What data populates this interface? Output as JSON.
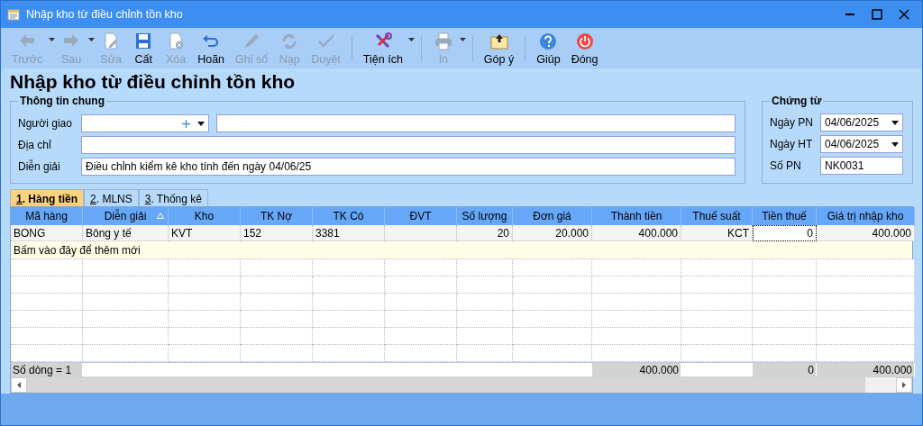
{
  "window": {
    "title": "Nhập kho từ điều chỉnh tồn kho"
  },
  "toolbar": [
    [
      {
        "label": "Trước",
        "kind": "back",
        "disabled": true,
        "dropdown": true
      },
      {
        "label": "Sau",
        "kind": "forward",
        "disabled": true,
        "dropdown": true
      },
      {
        "label": "Sửa",
        "kind": "edit",
        "disabled": true,
        "dropdown": false
      },
      {
        "label": "Cất",
        "kind": "save",
        "disabled": false,
        "dropdown": false
      },
      {
        "label": "Xóa",
        "kind": "delete",
        "disabled": true,
        "dropdown": false
      },
      {
        "label": "Hoãn",
        "kind": "undo",
        "disabled": false,
        "dropdown": false
      },
      {
        "label": "Ghi sổ",
        "kind": "pencil",
        "disabled": true,
        "dropdown": false
      },
      {
        "label": "Nạp",
        "kind": "refresh",
        "disabled": true,
        "dropdown": false
      },
      {
        "label": "Duyệt",
        "kind": "check",
        "disabled": true,
        "dropdown": false
      }
    ],
    [
      {
        "label": "Tiện ích",
        "kind": "tools",
        "disabled": false,
        "dropdown": true
      }
    ],
    [
      {
        "label": "In",
        "kind": "printer",
        "disabled": true,
        "dropdown": true
      }
    ],
    [
      {
        "label": "Góp ý",
        "kind": "envelope",
        "disabled": false,
        "dropdown": false
      }
    ],
    [
      {
        "label": "Giúp",
        "kind": "help",
        "disabled": false,
        "dropdown": false
      },
      {
        "label": "Đóng",
        "kind": "power",
        "disabled": false,
        "dropdown": false
      }
    ]
  ],
  "heading": "Nhập kho từ điều chỉnh tồn kho",
  "general": {
    "title": "Thông tin chung",
    "deliverer_label": "Người giao",
    "address_label": "Địa chỉ",
    "description_label": "Diễn giải",
    "description": "Điều chỉnh kiểm kê kho tính đến ngày 04/06/25"
  },
  "voucher": {
    "title": "Chứng từ",
    "fields": [
      {
        "label": "Ngày PN",
        "value": "04/06/2025",
        "kind": "date"
      },
      {
        "label": "Ngày HT",
        "value": "04/06/2025",
        "kind": "date"
      },
      {
        "label": "Số PN",
        "value": "NK0031",
        "kind": "text"
      }
    ]
  },
  "tabs": [
    {
      "accel": "1",
      "label": ". Hàng tiền",
      "selected": true
    },
    {
      "accel": "2",
      "label": ". MLNS",
      "selected": false
    },
    {
      "accel": "3",
      "label": ". Thống kê",
      "selected": false
    }
  ],
  "grid": {
    "columns": [
      {
        "title": "Mã hàng",
        "kind": "text",
        "sorted": false,
        "total": "Số dòng = 1"
      },
      {
        "title": "Diễn giải",
        "kind": "text",
        "sorted": true
      },
      {
        "title": "Kho",
        "kind": "text",
        "sorted": false
      },
      {
        "title": "TK Nợ",
        "kind": "text",
        "sorted": false
      },
      {
        "title": "TK Có",
        "kind": "text",
        "sorted": false
      },
      {
        "title": "ĐVT",
        "kind": "text",
        "sorted": false
      },
      {
        "title": "Số lượng",
        "kind": "number",
        "sorted": false
      },
      {
        "title": "Đơn giá",
        "kind": "number",
        "sorted": false
      },
      {
        "title": "Thành tiền",
        "kind": "number",
        "sorted": false,
        "total": "400.000"
      },
      {
        "title": "Thuế suất",
        "kind": "number",
        "sorted": false
      },
      {
        "title": "Tiền thuế",
        "kind": "number",
        "sorted": false,
        "total": "0"
      },
      {
        "title": "Giá trị nhập kho",
        "kind": "number",
        "sorted": false,
        "total": "400.000"
      }
    ],
    "rows": [
      {
        "cells": [
          {
            "text": "BONG",
            "focused": false
          },
          {
            "text": "Bông y tế",
            "focused": false
          },
          {
            "text": "KVT",
            "focused": false
          },
          {
            "text": "152",
            "focused": false
          },
          {
            "text": "3381",
            "focused": false
          },
          {
            "focused": false
          },
          {
            "text": "20",
            "focused": false
          },
          {
            "text": "20.000",
            "focused": false
          },
          {
            "text": "400.000",
            "focused": false
          },
          {
            "text": "KCT",
            "focused": false
          },
          {
            "text": "0",
            "focused": true
          },
          {
            "text": "400.000",
            "focused": false
          }
        ]
      }
    ],
    "new_row_prompt": "Bấm vào đây để thêm mới"
  }
}
